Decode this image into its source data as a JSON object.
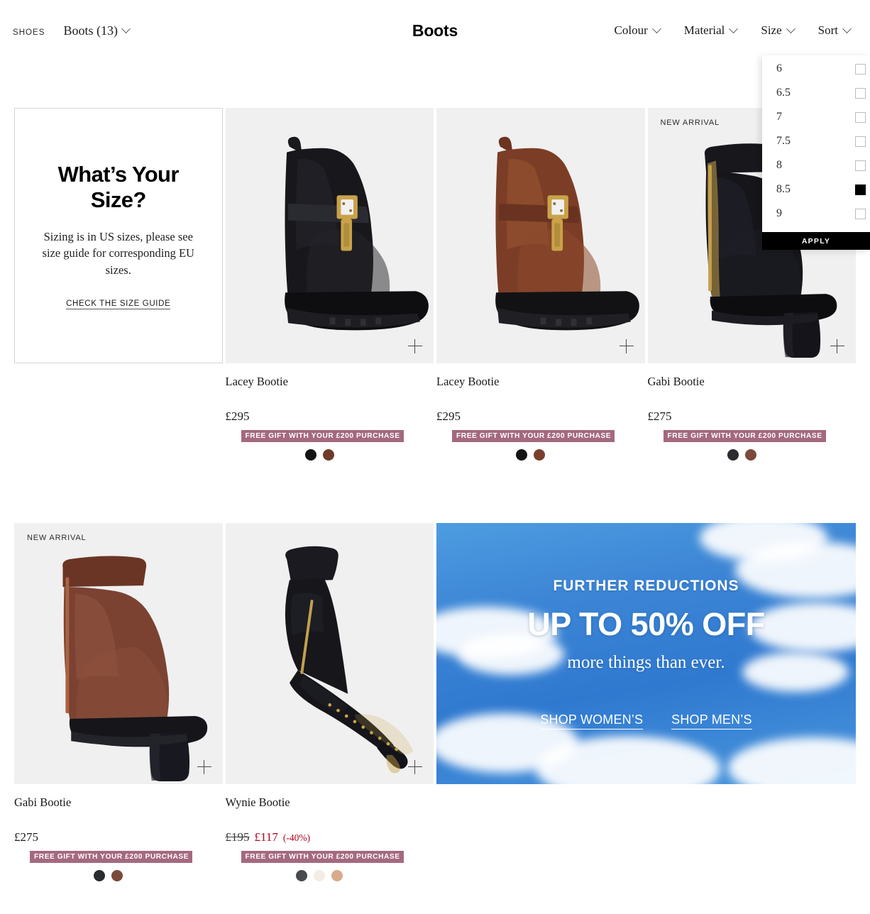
{
  "header": {
    "shoes_label": "SHOES",
    "category_label": "Boots (13)",
    "page_title": "Boots",
    "filters": [
      {
        "label": "Colour",
        "name": "colour"
      },
      {
        "label": "Material",
        "name": "material"
      },
      {
        "label": "Size",
        "name": "size"
      },
      {
        "label": "Sort",
        "name": "sort"
      }
    ]
  },
  "size_dropdown": {
    "open": true,
    "options": [
      {
        "label": "6",
        "checked": false
      },
      {
        "label": "6.5",
        "checked": false
      },
      {
        "label": "7",
        "checked": false
      },
      {
        "label": "7.5",
        "checked": false
      },
      {
        "label": "8",
        "checked": false
      },
      {
        "label": "8.5",
        "checked": true
      },
      {
        "label": "9",
        "checked": false
      }
    ],
    "apply_label": "APPLY"
  },
  "size_guide": {
    "title": "What’s Your Size?",
    "body": "Sizing is in US sizes, please see size guide for corresponding EU sizes.",
    "link_label": "CHECK THE SIZE GUIDE"
  },
  "badges": {
    "new_arrival": "NEW ARRIVAL",
    "free_gift": "FREE GIFT WITH YOUR £200 PURCHASE"
  },
  "products": [
    {
      "name": "Lacey Bootie",
      "price": "£295",
      "was_price": null,
      "discount": null,
      "new_arrival": false,
      "gift": true,
      "swatches": [
        "#141414",
        "#6f3b2a"
      ],
      "boot_style": "chelsea",
      "boot_color": "#15151a"
    },
    {
      "name": "Lacey Bootie",
      "price": "£295",
      "was_price": null,
      "discount": null,
      "new_arrival": false,
      "gift": true,
      "swatches": [
        "#141414",
        "#7a3f2c"
      ],
      "boot_style": "chelsea",
      "boot_color": "#7c3d26"
    },
    {
      "name": "Gabi Bootie",
      "price": "£275",
      "was_price": null,
      "discount": null,
      "new_arrival": true,
      "gift": true,
      "swatches": [
        "#2b2b30",
        "#7a4a3c"
      ],
      "boot_style": "heeled",
      "boot_color": "#16161b"
    },
    {
      "name": "Gabi Bootie",
      "price": "£275",
      "was_price": null,
      "discount": null,
      "new_arrival": true,
      "gift": true,
      "swatches": [
        "#2b2b30",
        "#7a4a3c"
      ],
      "boot_style": "heeled",
      "boot_color": "#7b4232"
    },
    {
      "name": "Wynie Bootie",
      "price": "£117",
      "was_price": "£195",
      "discount": "(-40%)",
      "new_arrival": false,
      "gift": true,
      "swatches": [
        "#484a4e",
        "#f2ece2",
        "#d9ab8c"
      ],
      "boot_style": "stiletto",
      "boot_color": "#16161a"
    }
  ],
  "promo": {
    "kicker": "FURTHER REDUCTIONS",
    "headline": "UP TO 50% OFF",
    "subhead": "more things than ever.",
    "links": [
      {
        "label": "SHOP WOMEN’S",
        "name": "shop-womens"
      },
      {
        "label": "SHOP MEN’S",
        "name": "shop-mens"
      }
    ]
  },
  "colors": {
    "gift_badge_bg": "#a4697f",
    "sale_red": "#b2001b",
    "media_bg": "#f0f0f0",
    "promo_sky": "#3d86d6"
  }
}
